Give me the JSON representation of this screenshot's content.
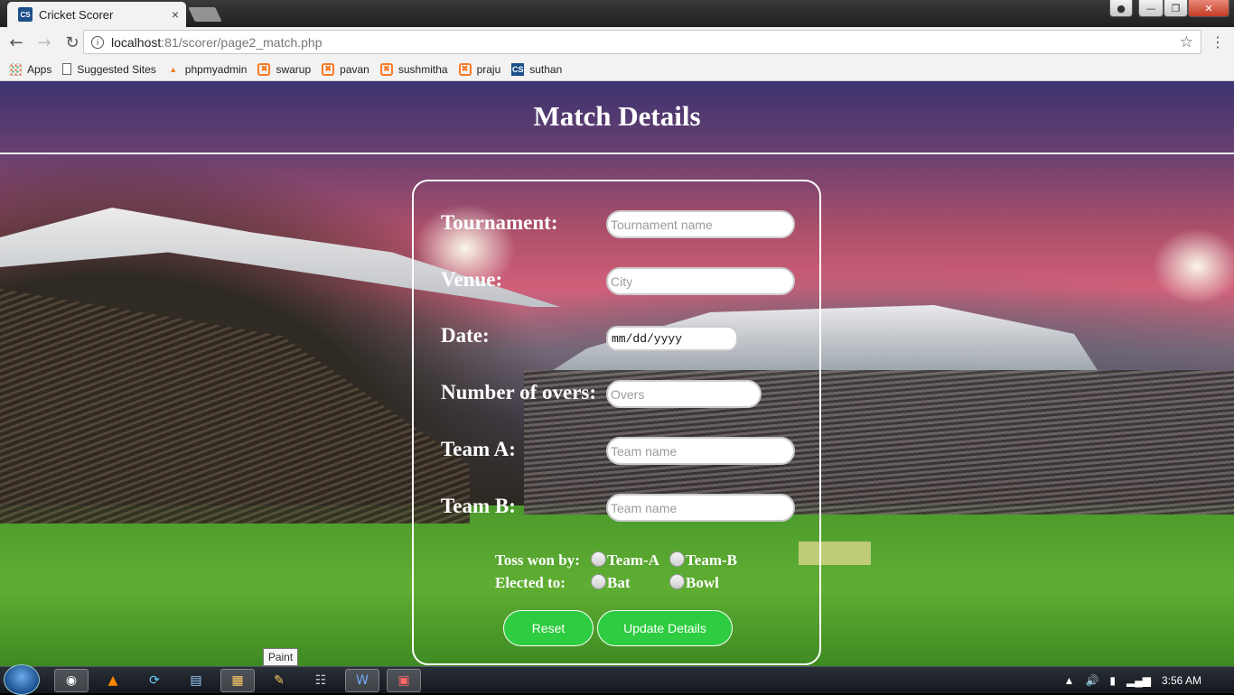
{
  "browser": {
    "tab_title": "Cricket Scorer",
    "tab_favicon": "CS",
    "tab_close": "×",
    "url_host": "localhost",
    "url_path": ":81/scorer/page2_match.php",
    "bookmarks": [
      {
        "label": "Apps",
        "icon": "apps-icon"
      },
      {
        "label": "Suggested Sites",
        "icon": "page-icon"
      },
      {
        "label": "phpmyadmin",
        "icon": "pma-icon"
      },
      {
        "label": "swarup",
        "icon": "xampp-icon"
      },
      {
        "label": "pavan",
        "icon": "xampp-icon"
      },
      {
        "label": "sushmitha",
        "icon": "xampp-icon"
      },
      {
        "label": "praju",
        "icon": "xampp-icon"
      },
      {
        "label": "suthan",
        "icon": "cs-icon"
      }
    ]
  },
  "page": {
    "title": "Match Details"
  },
  "form": {
    "tournament_label": "Tournament:",
    "tournament_placeholder": "Tournament name",
    "venue_label": "Venue:",
    "venue_placeholder": "City",
    "date_label": "Date:",
    "date_value": "mm/dd/yyyy",
    "overs_label": "Number of overs:",
    "overs_placeholder": "Overs",
    "team_a_label": "Team A:",
    "team_a_placeholder": "Team name",
    "team_b_label": "Team B:",
    "team_b_placeholder": "Team name",
    "toss_label": "Toss won by:",
    "toss_options": [
      "Team-A",
      "Team-B"
    ],
    "elected_label": "Elected to:",
    "elected_options": [
      "Bat",
      "Bowl"
    ],
    "reset_label": "Reset",
    "update_label": "Update Details"
  },
  "taskbar": {
    "tooltip": "Paint",
    "clock": "3:56 AM"
  },
  "colors": {
    "button_green": "#2ecc40"
  }
}
